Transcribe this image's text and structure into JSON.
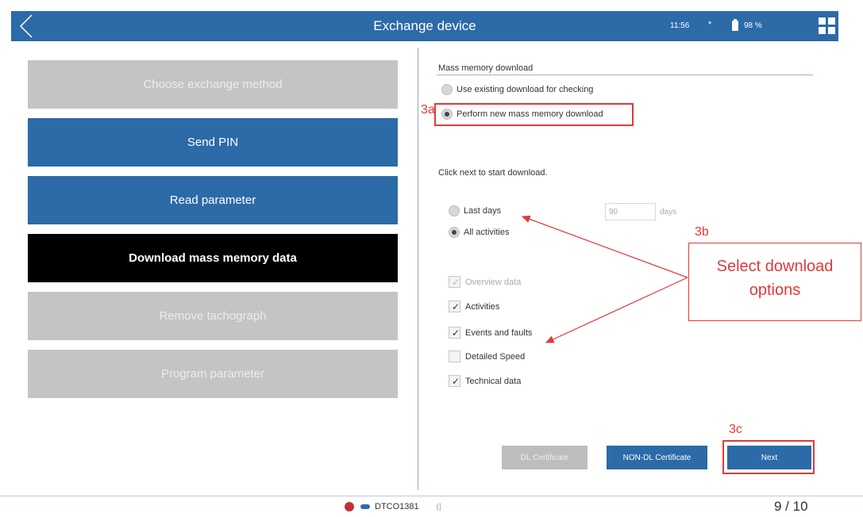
{
  "header": {
    "title": "Exchange device",
    "time": "11:56",
    "bluetooth_icon": "*",
    "battery": "98 %",
    "color": "#2c6aa8"
  },
  "steps": [
    {
      "label": "Choose exchange method",
      "state": "done"
    },
    {
      "label": "Send PIN",
      "state": "active"
    },
    {
      "label": "Read parameter",
      "state": "active"
    },
    {
      "label": "Download mass memory data",
      "state": "current"
    },
    {
      "label": "Remove tachograph",
      "state": "pending"
    },
    {
      "label": "Program parameter",
      "state": "pending"
    }
  ],
  "mass_memory": {
    "title": "Mass memory download",
    "option_existing": "Use existing download for checking",
    "option_new": "Perform new mass memory download",
    "selected": "new"
  },
  "info": "Click next to start download.",
  "range": {
    "last_days_label": "Last days",
    "days_value": "90",
    "days_unit": "days",
    "all_activities_label": "All activities",
    "selected": "all"
  },
  "data_options": [
    {
      "label": "Overview data",
      "checked": true,
      "disabled": true
    },
    {
      "label": "Activities",
      "checked": true,
      "disabled": false
    },
    {
      "label": "Events and faults",
      "checked": true,
      "disabled": false
    },
    {
      "label": "Detailed Speed",
      "checked": false,
      "disabled": false
    },
    {
      "label": "Technical data",
      "checked": true,
      "disabled": false
    }
  ],
  "buttons": {
    "dl_certificate": "DL Certificate",
    "non_dl_certificate": "NON-DL Certificate",
    "next": "Next"
  },
  "annotations": {
    "a": "3a",
    "b": "3b",
    "c": "3c",
    "callout": "Select download options",
    "color": "#e0393a"
  },
  "footer": {
    "device": "DTCO1381",
    "page": "9 / 10"
  }
}
